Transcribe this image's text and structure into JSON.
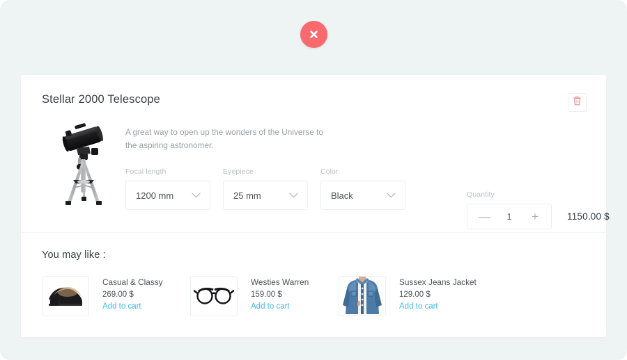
{
  "theme": {
    "page_bg": "#eef3f3",
    "card_bg": "#ffffff",
    "accent_close": "#f9696e",
    "accent_link": "#3fb8ea",
    "accent_trash": "#e8a0a0",
    "text_primary": "#3b4045",
    "text_muted": "#9aa0a6",
    "label_muted": "#b9bfc4",
    "border": "#eceff0"
  },
  "header": {
    "close_icon": "close-x-icon",
    "close_label": "Close"
  },
  "product": {
    "title": "Stellar 2000 Telescope",
    "description": "A great way to open up the wonders of the Universe to the aspiring astronomer.",
    "image_alt": "telescope-image",
    "delete_icon": "trash-icon",
    "delete_label": "Remove item",
    "options": [
      {
        "label": "Focal length",
        "value": "1200 mm",
        "name": "focal-length"
      },
      {
        "label": "Eyepiece",
        "value": "25 mm",
        "name": "eyepiece"
      },
      {
        "label": "Color",
        "value": "Black",
        "name": "color"
      }
    ],
    "quantity": {
      "label": "Quantity",
      "value": "1",
      "decrement_label": "—",
      "increment_label": "+"
    },
    "price": "1150.00  $"
  },
  "recommendations": {
    "title": "You may like :",
    "cta_label": "Add to cart",
    "items": [
      {
        "name": "Casual & Classy",
        "price": "269.00  $",
        "image_alt": "black-heel-shoes-image"
      },
      {
        "name": "Westies Warren",
        "price": "159.00  $",
        "image_alt": "eyeglasses-image"
      },
      {
        "name": "Sussex Jeans Jacket",
        "price": "129.00  $",
        "image_alt": "denim-jacket-image"
      }
    ]
  }
}
